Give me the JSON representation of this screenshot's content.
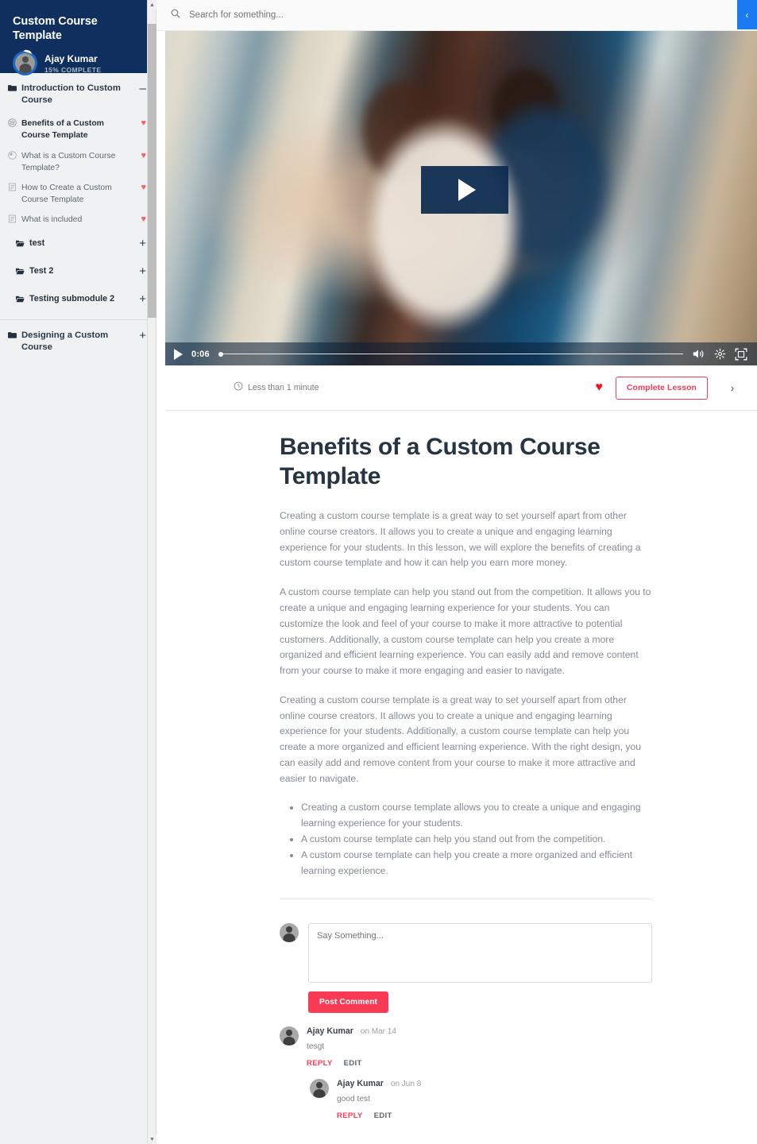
{
  "colors": {
    "sidebar_header_bg": "#0f2f5e",
    "accent_red": "#fb3a55",
    "heart_red": "#fb5a66",
    "toggle_blue": "#1a7bf2",
    "video_overlay": "#0b2a4f"
  },
  "sidebar": {
    "course_title": "Custom Course Template",
    "user": {
      "name": "Ajay Kumar",
      "progress_label": "15% COMPLETE",
      "progress_percent": 15
    },
    "modules": [
      {
        "title": "Introduction to Custom Course",
        "toggle": "–",
        "lessons": [
          {
            "label": "Benefits of a Custom Course Template",
            "icon": "video-circle-icon",
            "current": true,
            "heart": "♥"
          },
          {
            "label": "What is a Custom Course Template?",
            "icon": "clock-icon",
            "current": false,
            "heart": "♥"
          },
          {
            "label": "How to Create a Custom Course Template",
            "icon": "document-icon",
            "current": false,
            "heart": "♥"
          },
          {
            "label": "What is included",
            "icon": "document-icon",
            "current": false,
            "heart": "♥"
          }
        ],
        "submodules": [
          {
            "title": "test",
            "toggle": "+"
          },
          {
            "title": "Test 2",
            "toggle": "+"
          },
          {
            "title": "Testing submodule 2",
            "toggle": "+"
          }
        ]
      },
      {
        "title": "Designing a Custom Course",
        "toggle": "+",
        "lessons": [],
        "submodules": []
      }
    ]
  },
  "topbar": {
    "search_placeholder": "Search for something...",
    "search_value": "",
    "toggle_icon": "‹"
  },
  "video": {
    "time": "0:06",
    "progress_percent": 1,
    "play_label": "▶"
  },
  "lesson_bar": {
    "duration": "Less than 1 minute",
    "favorite_icon": "♥",
    "complete_label": "Complete Lesson",
    "next_icon": "›"
  },
  "main": {
    "title": "Benefits of a Custom Course Template",
    "paragraphs": [
      "Creating a custom course template is a great way to set yourself apart from other online course creators. It allows you to create a unique and engaging learning experience for your students. In this lesson, we will explore the benefits of creating a custom course template and how it can help you earn more money.",
      "A custom course template can help you stand out from the competition. It allows you to create a unique and engaging learning experience for your students. You can customize the look and feel of your course to make it more attractive to potential customers. Additionally, a custom course template can help you create a more organized and efficient learning experience. You can easily add and remove content from your course to make it more engaging and easier to navigate.",
      "Creating a custom course template is a great way to set yourself apart from other online course creators. It allows you to create a unique and engaging learning experience for your students. Additionally, a custom course template can help you create a more organized and efficient learning experience. With the right design, you can easily add and remove content from your course to make it more attractive and easier to navigate."
    ],
    "bullets": [
      "Creating a custom course template allows you to create a unique and engaging learning experience for your students.",
      "A custom course template can help you stand out from the competition.",
      "A custom course template can help you create a more organized and efficient learning experience."
    ]
  },
  "comments": {
    "placeholder": "Say Something...",
    "value": "",
    "post_label": "Post Comment",
    "items": [
      {
        "author": "Ajay Kumar",
        "date": "on Mar 14",
        "text": "tesgt",
        "reply_label": "REPLY",
        "edit_label": "EDIT"
      }
    ],
    "reply": {
      "author": "Ajay Kumar",
      "date": "on Jun 8",
      "text": "good test",
      "reply_label": "REPLY",
      "edit_label": "EDIT"
    }
  }
}
